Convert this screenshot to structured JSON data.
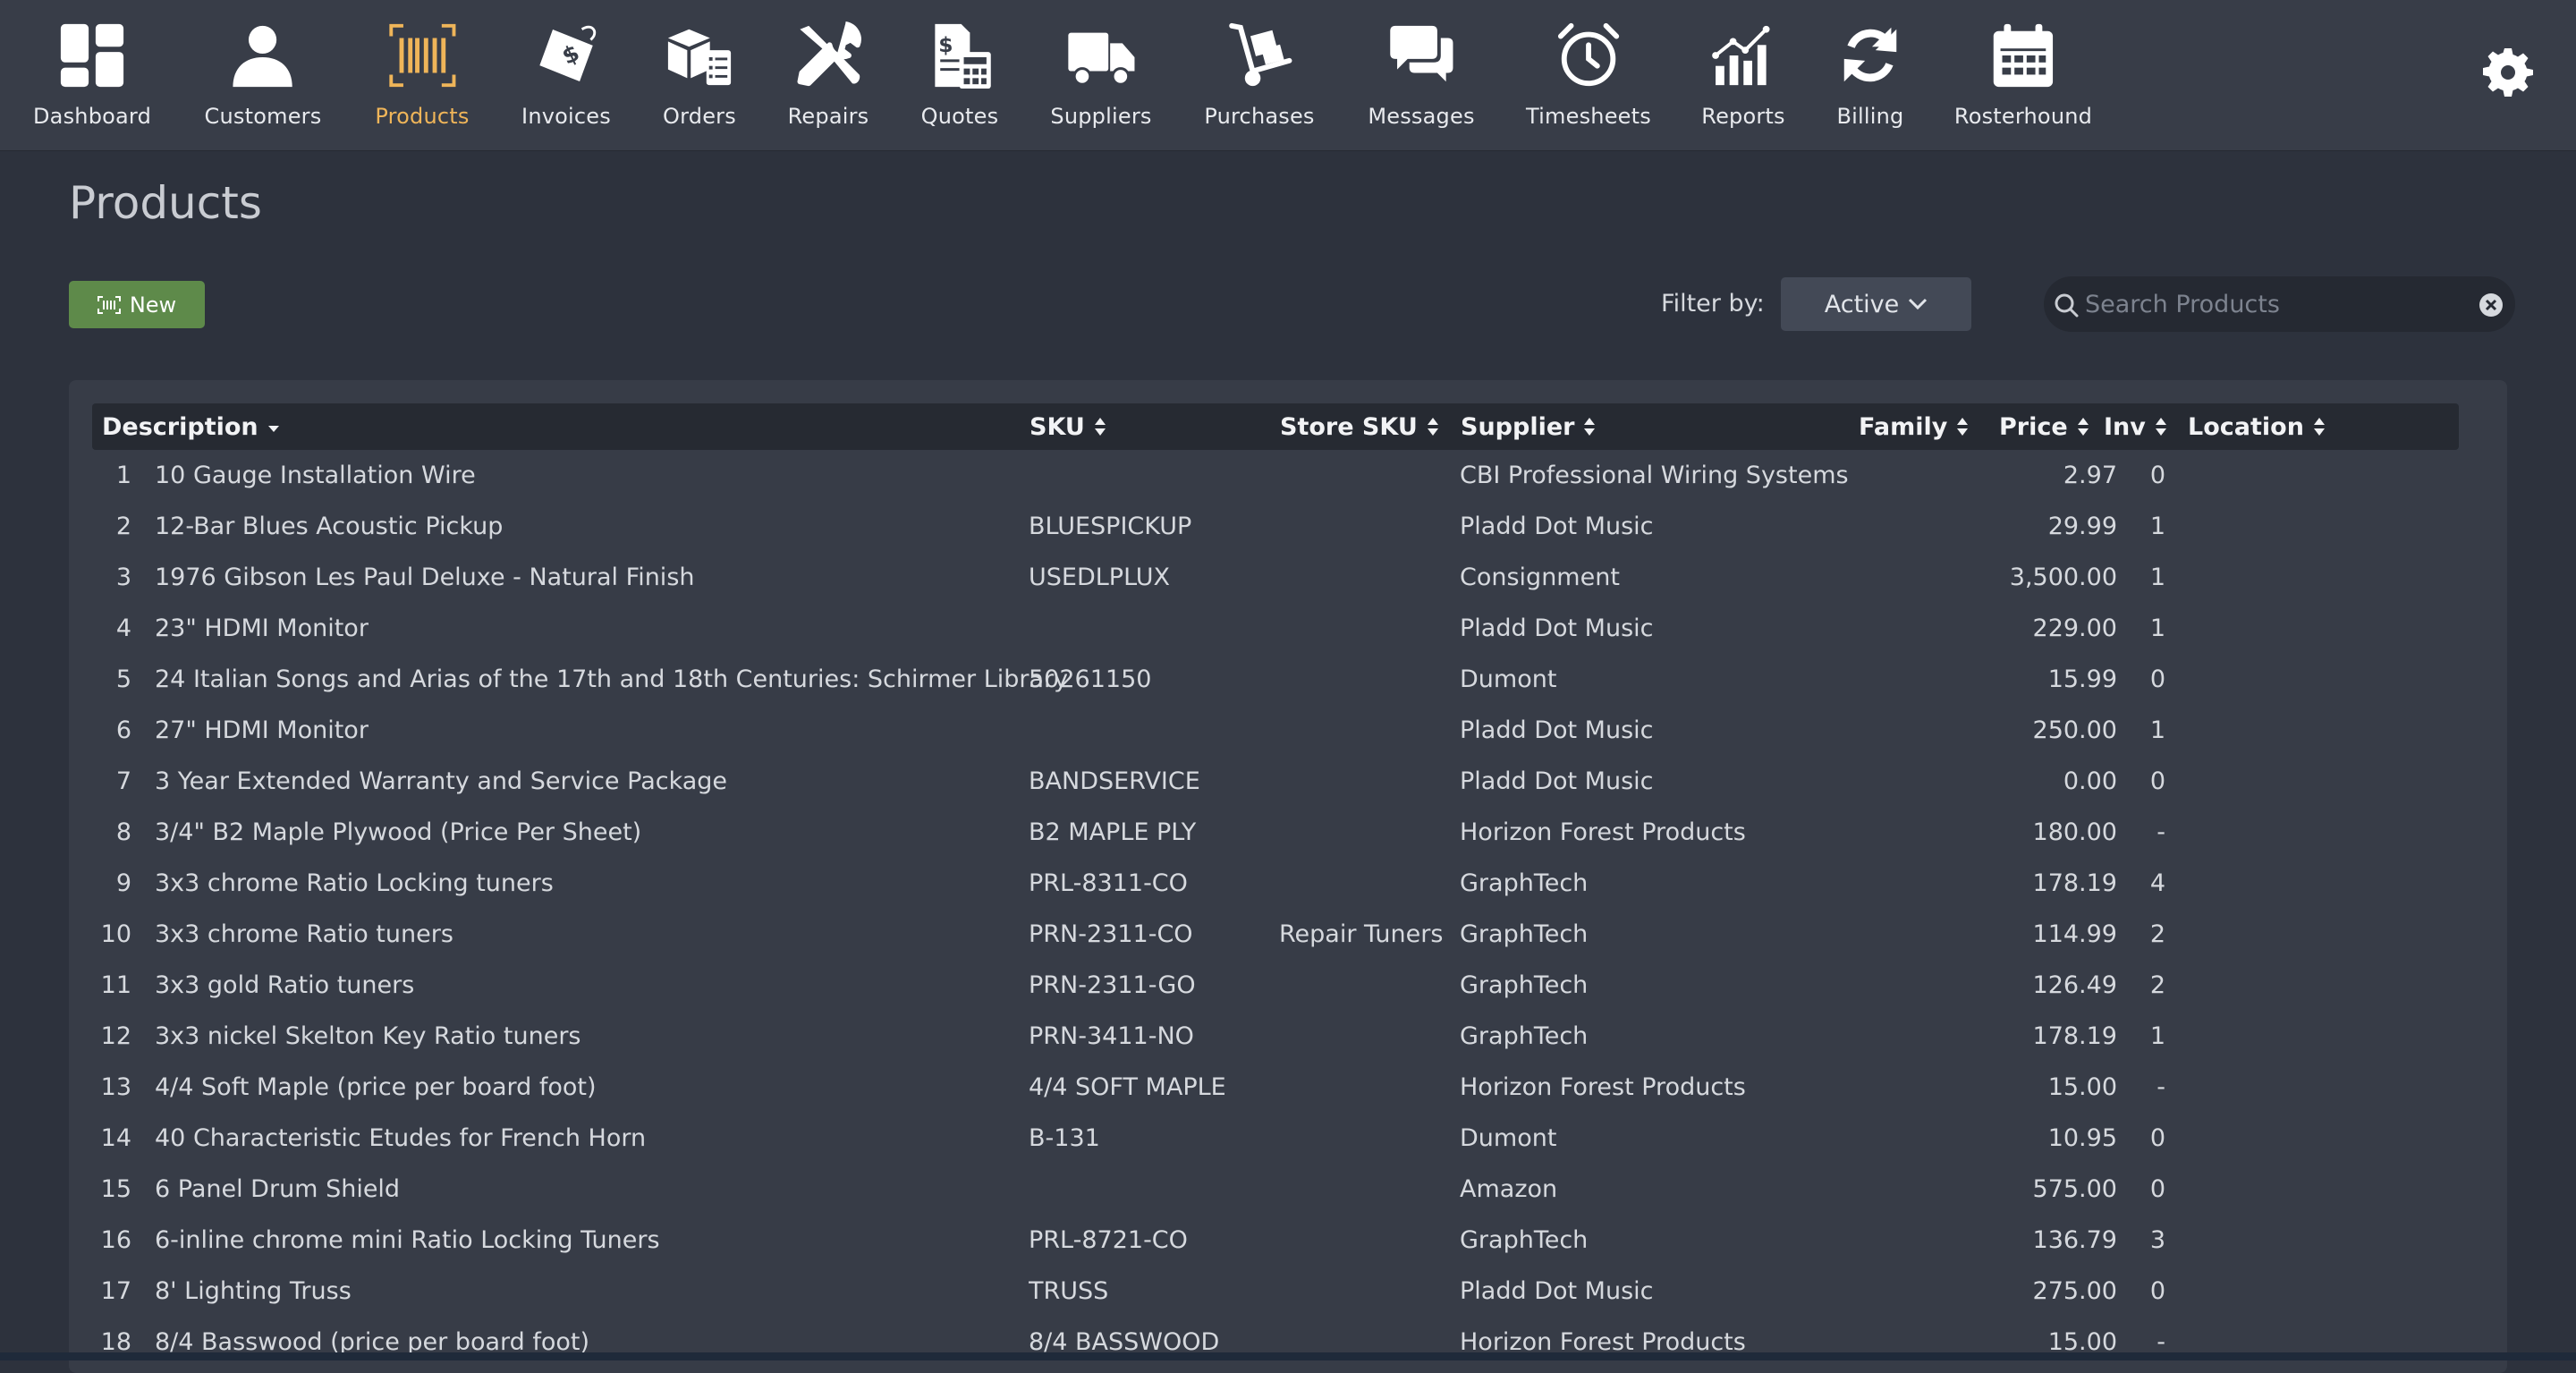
{
  "nav": {
    "items": [
      {
        "label": "Dashboard",
        "icon": "dashboard-icon",
        "active": false
      },
      {
        "label": "Customers",
        "icon": "customer-icon",
        "active": false
      },
      {
        "label": "Products",
        "icon": "barcode-icon",
        "active": true
      },
      {
        "label": "Invoices",
        "icon": "price-tag-icon",
        "active": false
      },
      {
        "label": "Orders",
        "icon": "boxes-checklist-icon",
        "active": false
      },
      {
        "label": "Repairs",
        "icon": "tools-icon",
        "active": false
      },
      {
        "label": "Quotes",
        "icon": "quote-calculator-icon",
        "active": false
      },
      {
        "label": "Suppliers",
        "icon": "truck-icon",
        "active": false
      },
      {
        "label": "Purchases",
        "icon": "hand-truck-icon",
        "active": false
      },
      {
        "label": "Messages",
        "icon": "chat-bubbles-icon",
        "active": false
      },
      {
        "label": "Timesheets",
        "icon": "alarm-clock-icon",
        "active": false
      },
      {
        "label": "Reports",
        "icon": "bar-chart-icon",
        "active": false
      },
      {
        "label": "Billing",
        "icon": "refresh-icon",
        "active": false
      },
      {
        "label": "Rosterhound",
        "icon": "calendar-icon",
        "active": false
      }
    ],
    "settings_icon": "gear-icon",
    "active_color": "#efb559"
  },
  "page": {
    "title": "Products",
    "new_label": "New",
    "filter_label": "Filter by:",
    "filter_value": "Active",
    "search_placeholder": "Search Products"
  },
  "table": {
    "columns": {
      "description": "Description",
      "sku": "SKU",
      "store_sku": "Store SKU",
      "supplier": "Supplier",
      "family": "Family",
      "price": "Price",
      "inv": "Inv",
      "location": "Location"
    },
    "sort": {
      "column": "Description",
      "direction": "descending-indicator"
    },
    "rows": [
      {
        "n": "1",
        "description": "10 Gauge Installation Wire",
        "sku": "",
        "store_sku": "",
        "supplier": "CBI Professional Wiring Systems",
        "family": "",
        "price": "2.97",
        "inv": "0",
        "location": ""
      },
      {
        "n": "2",
        "description": "12-Bar Blues Acoustic Pickup",
        "sku": "BLUESPICKUP",
        "store_sku": "",
        "supplier": "Pladd Dot Music",
        "family": "",
        "price": "29.99",
        "inv": "1",
        "location": ""
      },
      {
        "n": "3",
        "description": "1976 Gibson Les Paul Deluxe - Natural Finish",
        "sku": "USEDLPLUX",
        "store_sku": "",
        "supplier": "Consignment",
        "family": "",
        "price": "3,500.00",
        "inv": "1",
        "location": ""
      },
      {
        "n": "4",
        "description": "23\" HDMI Monitor",
        "sku": "",
        "store_sku": "",
        "supplier": "Pladd Dot Music",
        "family": "",
        "price": "229.00",
        "inv": "1",
        "location": ""
      },
      {
        "n": "5",
        "description": "24 Italian Songs and Arias of the 17th and 18th Centuries: Schirmer Library",
        "sku": "50261150",
        "store_sku": "",
        "supplier": "Dumont",
        "family": "",
        "price": "15.99",
        "inv": "0",
        "location": ""
      },
      {
        "n": "6",
        "description": "27\" HDMI Monitor",
        "sku": "",
        "store_sku": "",
        "supplier": "Pladd Dot Music",
        "family": "",
        "price": "250.00",
        "inv": "1",
        "location": ""
      },
      {
        "n": "7",
        "description": "3 Year Extended Warranty and Service Package",
        "sku": "BANDSERVICE",
        "store_sku": "",
        "supplier": "Pladd Dot Music",
        "family": "",
        "price": "0.00",
        "inv": "0",
        "location": ""
      },
      {
        "n": "8",
        "description": "3/4\" B2 Maple Plywood (Price Per Sheet)",
        "sku": "B2 MAPLE PLY",
        "store_sku": "",
        "supplier": "Horizon Forest Products",
        "family": "",
        "price": "180.00",
        "inv": "-",
        "location": ""
      },
      {
        "n": "9",
        "description": "3x3 chrome Ratio Locking tuners",
        "sku": "PRL-8311-CO",
        "store_sku": "",
        "supplier": "GraphTech",
        "family": "",
        "price": "178.19",
        "inv": "4",
        "location": ""
      },
      {
        "n": "10",
        "description": "3x3 chrome Ratio tuners",
        "sku": "PRN-2311-CO",
        "store_sku": "Repair Tuners",
        "supplier": "GraphTech",
        "family": "",
        "price": "114.99",
        "inv": "2",
        "location": ""
      },
      {
        "n": "11",
        "description": "3x3 gold Ratio tuners",
        "sku": "PRN-2311-GO",
        "store_sku": "",
        "supplier": "GraphTech",
        "family": "",
        "price": "126.49",
        "inv": "2",
        "location": ""
      },
      {
        "n": "12",
        "description": "3x3 nickel Skelton Key Ratio tuners",
        "sku": "PRN-3411-NO",
        "store_sku": "",
        "supplier": "GraphTech",
        "family": "",
        "price": "178.19",
        "inv": "1",
        "location": ""
      },
      {
        "n": "13",
        "description": "4/4 Soft Maple (price per board foot)",
        "sku": "4/4 SOFT MAPLE",
        "store_sku": "",
        "supplier": "Horizon Forest Products",
        "family": "",
        "price": "15.00",
        "inv": "-",
        "location": ""
      },
      {
        "n": "14",
        "description": "40 Characteristic Etudes for French Horn",
        "sku": "B-131",
        "store_sku": "",
        "supplier": "Dumont",
        "family": "",
        "price": "10.95",
        "inv": "0",
        "location": ""
      },
      {
        "n": "15",
        "description": "6 Panel Drum Shield",
        "sku": "",
        "store_sku": "",
        "supplier": "Amazon",
        "family": "",
        "price": "575.00",
        "inv": "0",
        "location": ""
      },
      {
        "n": "16",
        "description": "6-inline chrome mini Ratio Locking Tuners",
        "sku": "PRL-8721-CO",
        "store_sku": "",
        "supplier": "GraphTech",
        "family": "",
        "price": "136.79",
        "inv": "3",
        "location": ""
      },
      {
        "n": "17",
        "description": "8' Lighting Truss",
        "sku": "TRUSS",
        "store_sku": "",
        "supplier": "Pladd Dot Music",
        "family": "",
        "price": "275.00",
        "inv": "0",
        "location": ""
      },
      {
        "n": "18",
        "description": "8/4 Basswood (price per board foot)",
        "sku": "8/4 BASSWOOD",
        "store_sku": "",
        "supplier": "Horizon Forest Products",
        "family": "",
        "price": "15.00",
        "inv": "-",
        "location": ""
      }
    ]
  }
}
